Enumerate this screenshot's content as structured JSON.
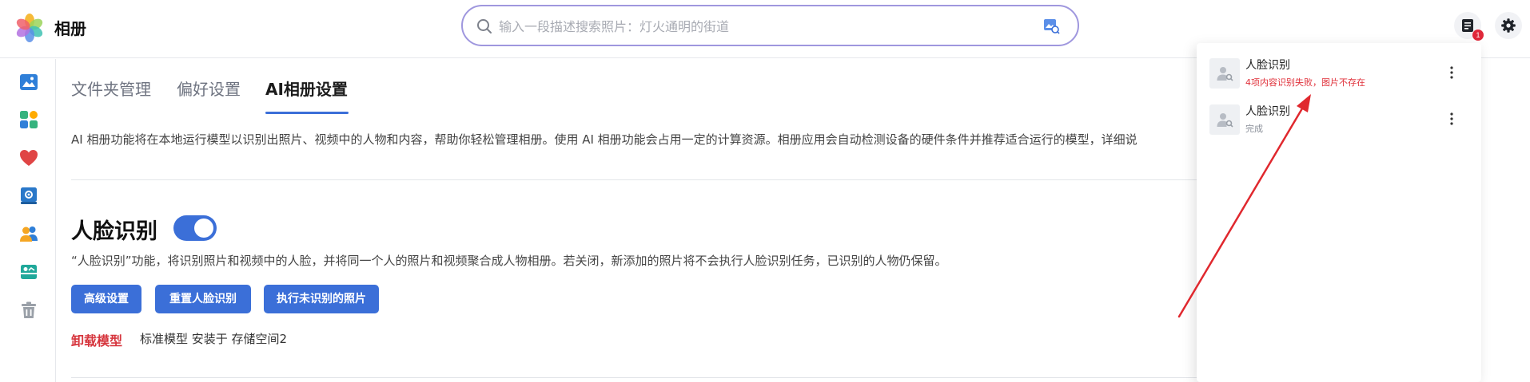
{
  "app": {
    "title": "相册"
  },
  "search": {
    "placeholder": "输入一段描述搜索照片：灯火通明的街道",
    "value": ""
  },
  "header": {
    "notification_badge": "1"
  },
  "sidebar": {
    "items": [
      {
        "icon": "image-icon"
      },
      {
        "icon": "apps-icon"
      },
      {
        "icon": "heart-icon"
      },
      {
        "icon": "album-icon"
      },
      {
        "icon": "people-icon"
      },
      {
        "icon": "shared-album-icon"
      },
      {
        "icon": "trash-icon"
      }
    ]
  },
  "tabs": [
    {
      "label": "文件夹管理",
      "active": false
    },
    {
      "label": "偏好设置",
      "active": false
    },
    {
      "label": "AI相册设置",
      "active": true
    }
  ],
  "main": {
    "description": "AI 相册功能将在本地运行模型以识别出照片、视频中的人物和内容，帮助你轻松管理相册。使用 AI 相册功能会占用一定的计算资源。相册应用会自动检测设备的硬件条件并推荐适合运行的模型，详细说",
    "face": {
      "title": "人脸识别",
      "enabled": true,
      "description": "“人脸识别”功能，将识别照片和视频中的人脸，并将同一个人的照片和视频聚合成人物相册。若关闭，新添加的照片将不会执行人脸识别任务，已识别的人物仍保留。",
      "buttons": {
        "advanced": "高级设置",
        "reset": "重置人脸识别",
        "run_unrecognized": "执行未识别的照片"
      },
      "uninstall_label": "卸载模型",
      "model_info": "标准模型 安装于 存储空间2"
    }
  },
  "notifications": [
    {
      "title": "人脸识别",
      "status": "4项内容识别失败，图片不存在",
      "status_color": "#e0313b"
    },
    {
      "title": "人脸识别",
      "status": "完成",
      "status_color": "#8a8f99"
    }
  ],
  "colors": {
    "accent": "#3b6fd8",
    "error": "#e0313b",
    "annotation_arrow": "#e0282e"
  }
}
